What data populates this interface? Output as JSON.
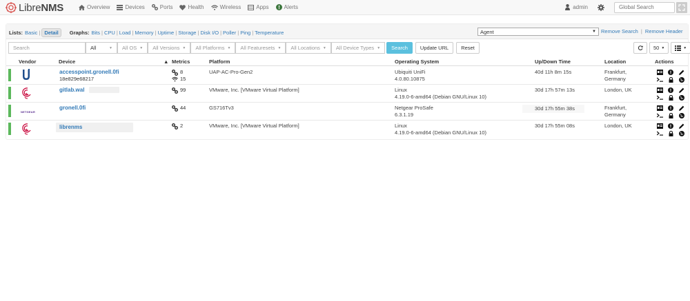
{
  "brand": {
    "name_a": "Libre",
    "name_b": "NMS"
  },
  "nav": [
    {
      "label": "Overview",
      "icon": "home-icon"
    },
    {
      "label": "Devices",
      "icon": "server-icon"
    },
    {
      "label": "Ports",
      "icon": "link-icon"
    },
    {
      "label": "Health",
      "icon": "heartbeat-icon"
    },
    {
      "label": "Wireless",
      "icon": "wifi-icon"
    },
    {
      "label": "Apps",
      "icon": "tasks-icon"
    },
    {
      "label": "Alerts",
      "icon": "exclamation-circle-icon"
    }
  ],
  "user": {
    "name": "admin"
  },
  "global_search": {
    "placeholder": "Global Search"
  },
  "lists": {
    "label": "Lists:",
    "basic": "Basic",
    "detail": "Detail",
    "graphs_label": "Graphs:",
    "graphs": [
      "Bits",
      "CPU",
      "Load",
      "Memory",
      "Uptime",
      "Storage",
      "Disk I/O",
      "Poller",
      "Ping",
      "Temperature"
    ]
  },
  "agent_select": {
    "value": "Agent"
  },
  "remove_search": "Remove Search",
  "remove_header": "Remove Header",
  "filters": {
    "search_placeholder": "Search",
    "all": "All",
    "all_os": "All OS",
    "all_versions": "All Versions",
    "all_platforms": "All Platforms",
    "all_featuresets": "All Featuresets",
    "all_locations": "All Locations",
    "all_device_types": "All Device Types",
    "search_button": "Search",
    "update_url": "Update URL",
    "reset": "Reset",
    "page_size": "50"
  },
  "columns": {
    "vendor": "Vendor",
    "device": "Device",
    "metrics": "Metrics",
    "platform": "Platform",
    "os": "Operating System",
    "uptime": "Up/Down Time",
    "location": "Location",
    "actions": "Actions"
  },
  "colors": {
    "status_up": "#5cb85c",
    "link": "#337ab7",
    "search_button": "#5bc0de"
  },
  "devices": [
    {
      "vendor_icon": "ubiquiti-logo",
      "name": "accesspoint.gronell.0fi",
      "sub": "18e829e68217",
      "metric_ports": "8",
      "metric_wireless": "15",
      "platform": "UAP-AC-Pro-Gen2",
      "os": "Ubiquiti UniFi",
      "os_version": "4.0.80.10875",
      "uptime": "40d 11h 8m 15s",
      "location": "Frankfurt, Germany"
    },
    {
      "vendor_icon": "debian-logo",
      "name": "gitlab.wal",
      "sub": "",
      "metric_ports": "99",
      "metric_wireless": "",
      "platform": "VMware, Inc. [VMware Virtual Platform]",
      "os": "Linux",
      "os_version": "4.19.0-6-amd64 (Debian GNU/Linux 10)",
      "uptime": "30d 17h 57m 13s",
      "location": "London, UK"
    },
    {
      "vendor_icon": "netgear-logo",
      "vendor_text": "NETGEAR",
      "name": "gronell.0fi",
      "sub": "",
      "metric_ports": "44",
      "metric_wireless": "",
      "platform": "GS716Tv3",
      "os": "Netgear ProSafe",
      "os_version": "6.3.1.19",
      "uptime": "30d 17h 55m 38s",
      "location": "Frankfurt, Germany"
    },
    {
      "vendor_icon": "debian-logo",
      "name": "librenms",
      "sub": "",
      "metric_ports": "2",
      "metric_wireless": "",
      "platform": "VMware, Inc. [VMware Virtual Platform]",
      "os": "Linux",
      "os_version": "4.19.0-6-amd64 (Debian GNU/Linux 10)",
      "uptime": "30d 17h 55m 08s",
      "location": "London, UK"
    }
  ]
}
